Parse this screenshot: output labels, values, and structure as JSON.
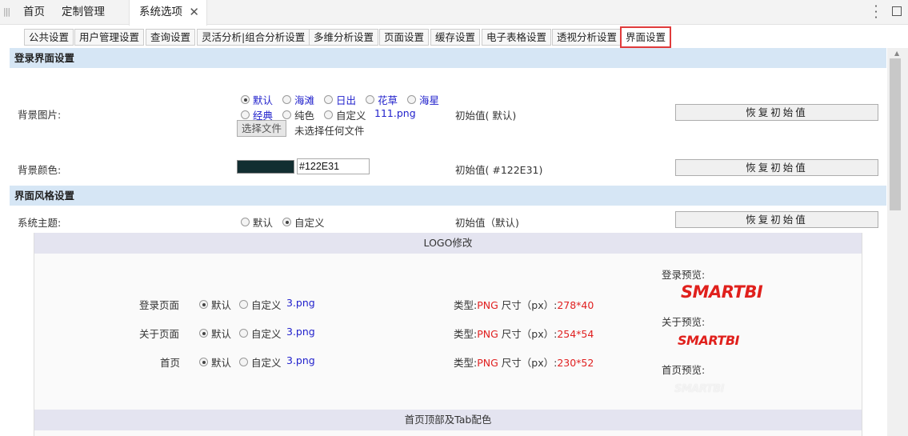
{
  "top_tabs": {
    "home": "首页",
    "custom": "定制管理",
    "system": "系统选项",
    "close_icon": "close-icon"
  },
  "sub_tabs": [
    "公共设置",
    "用户管理设置",
    "查询设置",
    "灵活分析|组合分析设置",
    "多维分析设置",
    "页面设置",
    "缓存设置",
    "电子表格设置",
    "透视分析设置",
    "界面设置"
  ],
  "login_section": {
    "title": "登录界面设置",
    "bg_image_label": "背景图片:",
    "bg_options_row1": [
      "默认",
      "海滩",
      "日出",
      "花草",
      "海星"
    ],
    "bg_options_row2": [
      "经典",
      "纯色",
      "自定义"
    ],
    "bg_filename": "111.png",
    "file_button": "选择文件",
    "file_status": "未选择任何文件",
    "bg_image_initial": "初始值( 默认)",
    "bg_color_label": "背景颜色:",
    "bg_color_value": "#122E31",
    "bg_color_initial": "初始值( #122E31)",
    "reset_button": "恢复初始值"
  },
  "style_section": {
    "title": "界面风格设置",
    "theme_label": "系统主题:",
    "theme_options": [
      "默认",
      "自定义"
    ],
    "theme_initial": "初始值（默认)",
    "reset_button": "恢复初始值"
  },
  "logo_panel": {
    "title": "LOGO修改",
    "rows": [
      {
        "label": "登录页面",
        "opt_default": "默认",
        "opt_custom": "自定义",
        "file": "3.png",
        "type_label": "类型:",
        "type": "PNG",
        "size_label": "尺寸（px）:",
        "size": "278*40"
      },
      {
        "label": "关于页面",
        "opt_default": "默认",
        "opt_custom": "自定义",
        "file": "3.png",
        "type_label": "类型:",
        "type": "PNG",
        "size_label": "尺寸（px）:",
        "size": "254*54"
      },
      {
        "label": "首页",
        "opt_default": "默认",
        "opt_custom": "自定义",
        "file": "3.png",
        "type_label": "类型:",
        "type": "PNG",
        "size_label": "尺寸（px）:",
        "size": "230*52"
      }
    ],
    "preview_login": "登录预览:",
    "preview_about": "关于预览:",
    "preview_home": "首页预览:",
    "logo_text": "SMARTBI"
  },
  "color_panel": {
    "title": "首页顶部及Tab配色"
  },
  "colors": {
    "section_bg": "#d6e6f5",
    "bg_swatch": "#122E31",
    "active_tab_border": "#e03b3b",
    "link": "#2222cc",
    "logo_red": "#e0201c"
  }
}
